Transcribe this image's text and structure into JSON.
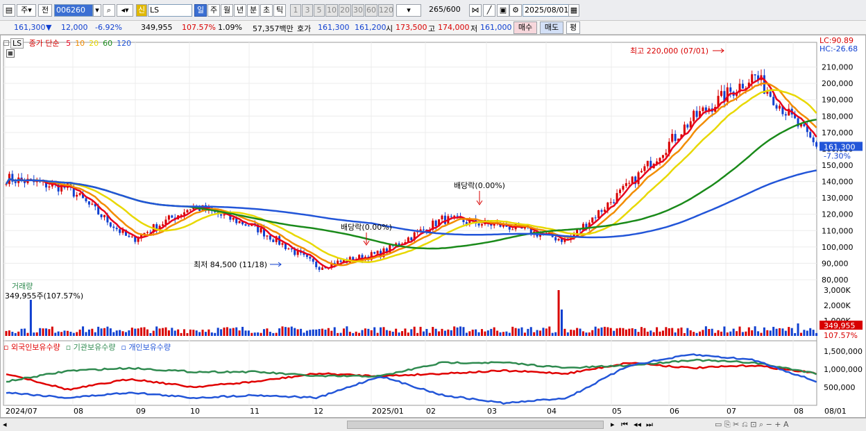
{
  "toolbar": {
    "market": "주",
    "prev": "전",
    "code": "006260",
    "name_badge": "신",
    "name": "LS",
    "periods": [
      "일",
      "주",
      "월",
      "년",
      "분",
      "초",
      "틱"
    ],
    "minutes": [
      "1",
      "3",
      "5",
      "10",
      "20",
      "30",
      "60",
      "120"
    ],
    "count": "265",
    "count_total": "/600",
    "date": "2025/08/01"
  },
  "quote": {
    "price": "161,300",
    "arrow": "▼",
    "change": "12,000",
    "change_pct": "-6.92%",
    "volume": "349,955",
    "volume_pct": "107.57%",
    "turnover_pct": "1.09%",
    "amount": "57,357백만",
    "bid_label": "호가",
    "bid1": "161,300",
    "bid2": "161,200",
    "open_label": "시",
    "open": "173,500",
    "high_label": "고",
    "high": "174,000",
    "low_label": "저",
    "low": "161,000",
    "buy": "매수",
    "sell": "매도",
    "eval": "평"
  },
  "legend": {
    "symbol": "LS",
    "label": "종가 단순",
    "ma": [
      {
        "p": "5",
        "c": "#e8001c"
      },
      {
        "p": "10",
        "c": "#f28c00"
      },
      {
        "p": "20",
        "c": "#e8d800"
      },
      {
        "p": "60",
        "c": "#1a8a1a"
      },
      {
        "p": "120",
        "c": "#2255d8"
      }
    ]
  },
  "lc_label": "LC:90.89",
  "hc_label": "HC:-26.68",
  "annotations": {
    "high": "최고 220,000 (07/01)",
    "low": "최저 84,500 (11/18)",
    "div1": "배당락(0.00%)",
    "div2": "배당락(0.00%)"
  },
  "price_axis": [
    "210,000",
    "200,000",
    "190,000",
    "180,000",
    "170,000",
    "160,000",
    "150,000",
    "140,000",
    "130,000",
    "120,000",
    "110,000",
    "100,000",
    "90,000",
    "80,000"
  ],
  "last_price_box": "161,300",
  "last_pct_box": "-7.30%",
  "volume_panel": {
    "title": "거래량",
    "value": "349,955주(107.57%)",
    "axis": [
      "3,000K",
      "2,000K",
      "1,000K"
    ],
    "last_box": "349,955",
    "last_pct": "107.57%"
  },
  "holding_panel": {
    "series": [
      {
        "name": "외국인보유수량",
        "c": "#e00000"
      },
      {
        "name": "기관보유수량",
        "c": "#2f8a4f"
      },
      {
        "name": "개인보유수량",
        "c": "#2255d8"
      }
    ],
    "axis": [
      "1,500,000",
      "1,000,000",
      "500,000"
    ]
  },
  "x_axis": [
    "2024/07",
    "08",
    "09",
    "10",
    "11",
    "12",
    "2025/01",
    "02",
    "03",
    "04",
    "05",
    "06",
    "07",
    "08",
    "08/01"
  ],
  "colors": {
    "up": "#d80000",
    "down": "#1040d0",
    "accent": "#3b6fd3"
  },
  "chart_data": [
    {
      "type": "candlestick",
      "title": "LS",
      "ylim": [
        80000,
        220000
      ],
      "x": [
        "2024/07",
        "08",
        "09",
        "10",
        "11",
        "12",
        "2025/01",
        "02",
        "03",
        "04",
        "05",
        "06",
        "07",
        "08"
      ],
      "close": [
        142000,
        136000,
        104000,
        125000,
        112000,
        88000,
        96000,
        117000,
        113000,
        104000,
        138000,
        178000,
        205000,
        161300
      ],
      "ma_periods": [
        5,
        10,
        20,
        60,
        120
      ],
      "high_point": {
        "date": "07/01",
        "value": 220000
      },
      "low_point": {
        "date": "11/18",
        "value": 84500
      }
    },
    {
      "type": "bar",
      "title": "거래량",
      "ylim": [
        0,
        3000000
      ],
      "last": 349955
    },
    {
      "type": "line",
      "series": [
        {
          "name": "외국인보유수량"
        },
        {
          "name": "기관보유수량"
        },
        {
          "name": "개인보유수량"
        }
      ],
      "ylim": [
        300000,
        1700000
      ]
    }
  ]
}
